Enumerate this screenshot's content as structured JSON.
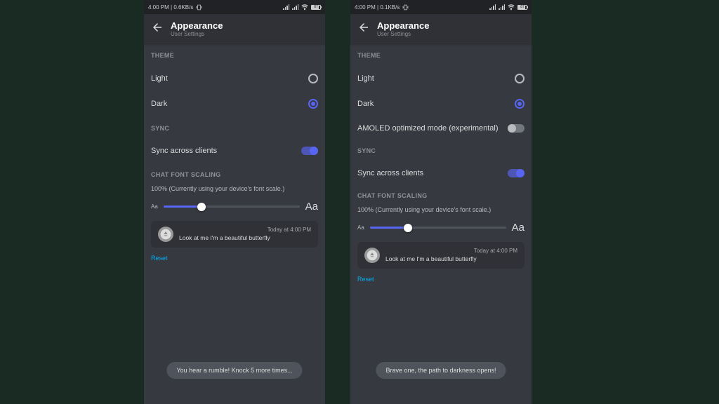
{
  "left": {
    "status": {
      "time_net": "4:00 PM | 0.6KB/s",
      "battery_pct": "87"
    },
    "header": {
      "title": "Appearance",
      "subtitle": "User Settings"
    },
    "theme": {
      "header": "THEME",
      "light": "Light",
      "dark": "Dark"
    },
    "sync": {
      "header": "SYNC",
      "label": "Sync across clients"
    },
    "font": {
      "header": "CHAT FONT SCALING",
      "desc": "100% (Currently using your device's font scale.)",
      "aa_small": "Aa",
      "aa_large": "Aa"
    },
    "preview": {
      "meta": "Today at 4:00 PM",
      "msg": "Look at me I'm a beautiful butterfly"
    },
    "reset": "Reset",
    "toast": "You hear a rumble! Knock 5 more times..."
  },
  "right": {
    "status": {
      "time_net": "4:00 PM | 0.1KB/s",
      "battery_pct": "87"
    },
    "header": {
      "title": "Appearance",
      "subtitle": "User Settings"
    },
    "theme": {
      "header": "THEME",
      "light": "Light",
      "dark": "Dark",
      "amoled": "AMOLED optimized mode (experimental)"
    },
    "sync": {
      "header": "SYNC",
      "label": "Sync across clients"
    },
    "font": {
      "header": "CHAT FONT SCALING",
      "desc": "100% (Currently using your device's font scale.)",
      "aa_small": "Aa",
      "aa_large": "Aa"
    },
    "preview": {
      "meta": "Today at 4:00 PM",
      "msg": "Look at me I'm a beautiful butterfly"
    },
    "reset": "Reset",
    "toast": "Brave one, the path to darkness opens!"
  }
}
